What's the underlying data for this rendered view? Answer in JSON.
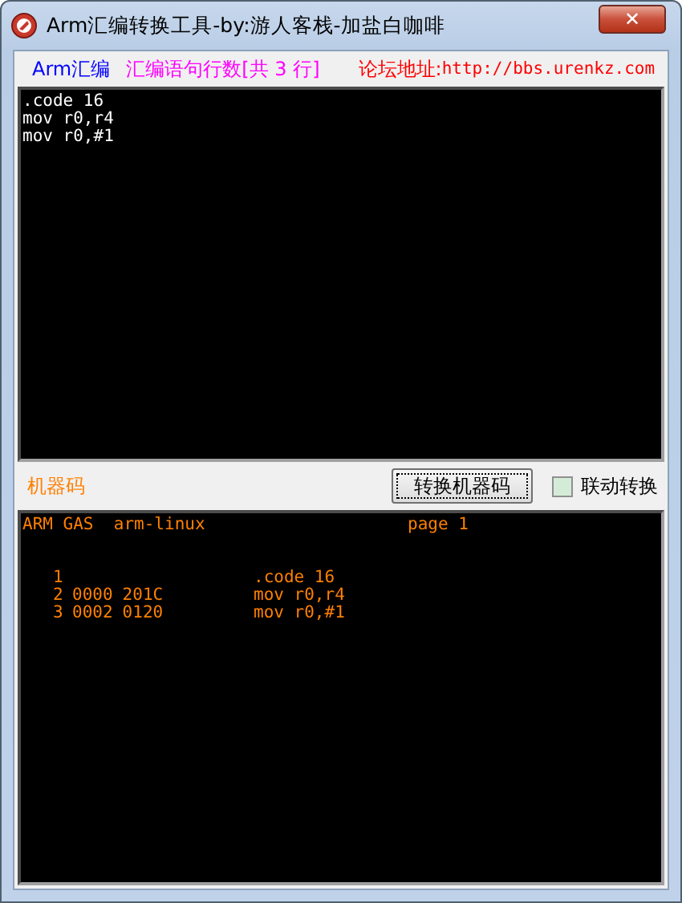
{
  "window": {
    "title": "Arm汇编转换工具-by:游人客栈-加盐白咖啡",
    "close": "✕"
  },
  "top_bar": {
    "asm_label": "Arm汇编",
    "line_count": "汇编语句行数[共 3 行]",
    "forum_label": "论坛地址:",
    "forum_url": "http://bbs.urenkz.com"
  },
  "source_lines": [
    ".code 16",
    "mov r0,r4",
    "mov r0,#1"
  ],
  "middle_bar": {
    "output_label": "机器码",
    "convert_button": "转换机器码",
    "auto_convert": {
      "label": "联动转换",
      "checked": false
    }
  },
  "output": {
    "header": {
      "left": "ARM GAS  arm-linux",
      "right": "page 1"
    },
    "rows": [
      {
        "line": "1",
        "address": "",
        "opcode": "",
        "source": ".code 16"
      },
      {
        "line": "2",
        "address": "0000",
        "opcode": "201C",
        "source": "mov r0,r4"
      },
      {
        "line": "3",
        "address": "0002",
        "opcode": "0120",
        "source": "mov r0,#1"
      }
    ]
  }
}
